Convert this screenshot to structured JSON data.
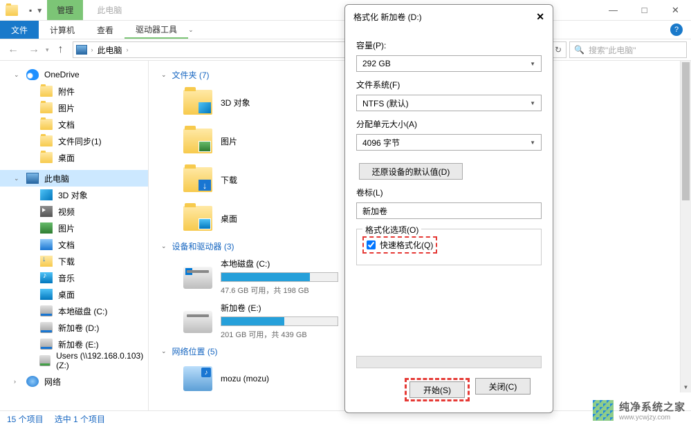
{
  "titlebar": {
    "tab_manage": "管理",
    "title_text": "此电脑"
  },
  "win_controls": {
    "min": "—",
    "max": "□",
    "close": "✕"
  },
  "ribbon": {
    "file": "文件",
    "computer": "计算机",
    "view": "查看",
    "drive_tools": "驱动器工具",
    "help": "?"
  },
  "addrbar": {
    "back_icon": "←",
    "fwd_icon": "→",
    "up_icon": "↑",
    "path_sep": "›",
    "location": "此电脑",
    "refresh": "↻",
    "search_placeholder": "搜索\"此电脑\""
  },
  "sidebar": {
    "onedrive": "OneDrive",
    "items1": [
      "附件",
      "图片",
      "文档",
      "文件同步(1)",
      "桌面"
    ],
    "this_pc": "此电脑",
    "items2": [
      "3D 对象",
      "视频",
      "图片",
      "文档",
      "下载",
      "音乐",
      "桌面",
      "本地磁盘 (C:)",
      "新加卷 (D:)",
      "新加卷 (E:)",
      "Users (\\\\192.168.0.103) (Z:)"
    ],
    "network": "网络"
  },
  "content": {
    "folders_header": "文件夹 (7)",
    "folders": [
      "3D 对象",
      "图片",
      "下载",
      "桌面"
    ],
    "drives_header": "设备和驱动器 (3)",
    "drives": [
      {
        "name": "本地磁盘 (C:)",
        "stats": "47.6 GB 可用，共 198 GB",
        "fill": 76
      },
      {
        "name": "新加卷 (E:)",
        "stats": "201 GB 可用，共 439 GB",
        "fill": 54
      }
    ],
    "network_header": "网络位置 (5)",
    "network_items": [
      "mozu (mozu)"
    ]
  },
  "statusbar": {
    "items": "15 个项目",
    "selected": "选中 1 个项目"
  },
  "dialog": {
    "title": "格式化 新加卷 (D:)",
    "close": "✕",
    "capacity_label": "容量(P):",
    "capacity_value": "292 GB",
    "fs_label": "文件系统(F)",
    "fs_value": "NTFS (默认)",
    "alloc_label": "分配单元大小(A)",
    "alloc_value": "4096 字节",
    "restore_btn": "还原设备的默认值(D)",
    "volume_label": "卷标(L)",
    "volume_value": "新加卷",
    "options_legend": "格式化选项(O)",
    "quick_format": "快速格式化(Q)",
    "start_btn": "开始(S)",
    "close_btn": "关闭(C)"
  },
  "watermark": {
    "text": "纯净系统之家",
    "url": "www.ycwjzy.com"
  }
}
